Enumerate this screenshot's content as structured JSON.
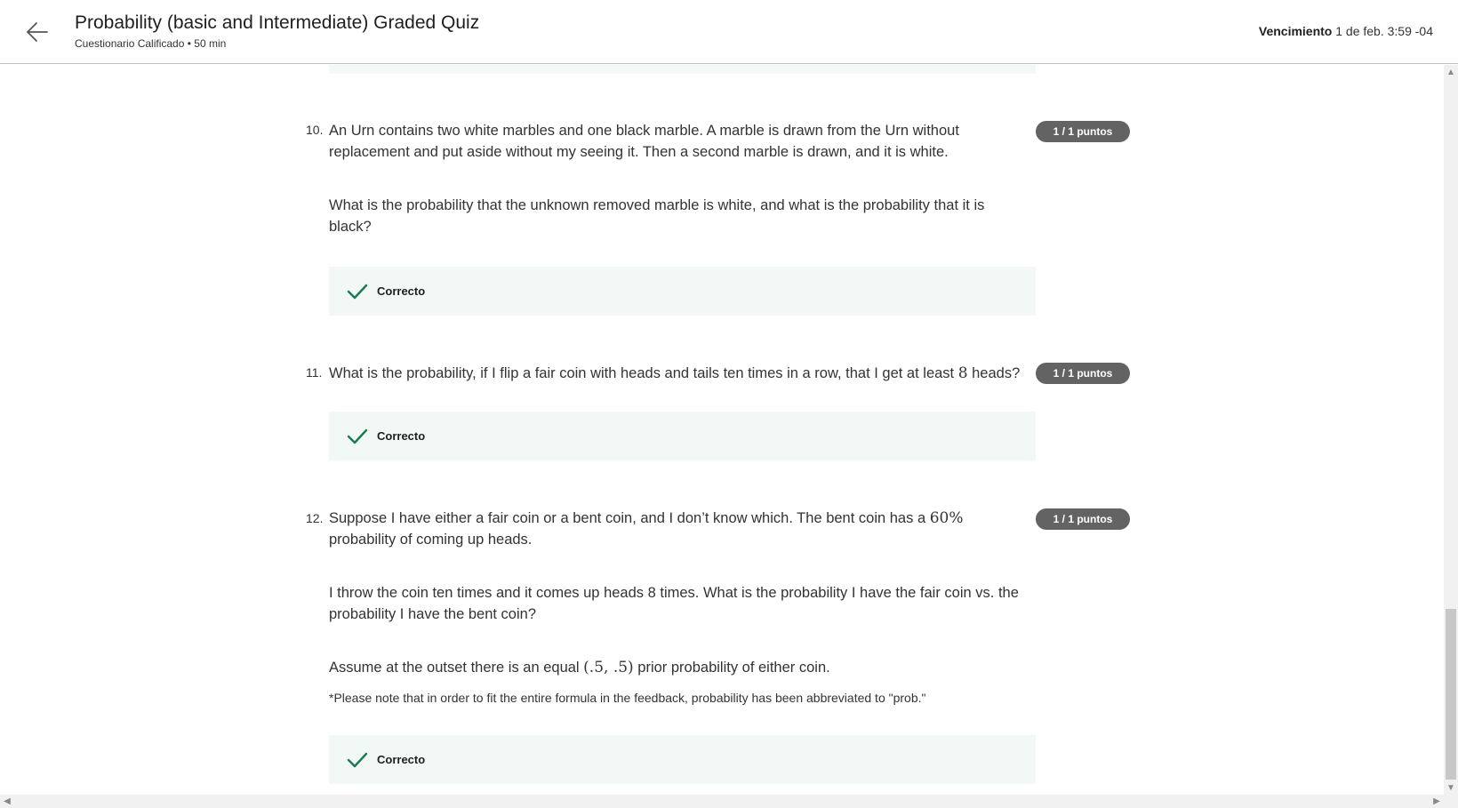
{
  "header": {
    "title": "Probability (basic and Intermediate) Graded Quiz",
    "subtitle": "Cuestionario Calificado • 50 min",
    "due_label": "Vencimiento",
    "due_value": "1 de feb. 3:59 -04"
  },
  "questions": [
    {
      "number": "10.",
      "text_1": "An Urn contains two white marbles and one black marble. A marble is drawn from the Urn without replacement and put aside without my seeing it. Then a second marble is drawn, and it is white.",
      "text_2": "What is the probability that the unknown removed marble is white, and what is the probability that it is black?",
      "badge": "1 / 1 puntos",
      "feedback": "Correcto"
    },
    {
      "number": "11.",
      "text_pre": "What is the probability, if I flip a fair coin with heads and tails ten times in a row, that I get at least ",
      "math": "8",
      "text_post": " heads?",
      "badge": "1 / 1 puntos",
      "feedback": "Correcto"
    },
    {
      "number": "12.",
      "text_pre": "Suppose I have either a fair coin or a bent coin, and I don’t know which. The bent coin has a ",
      "math": "60%",
      "text_post": " probability of coming up heads.",
      "text_2": "I throw the coin ten times and it comes up heads 8 times. What is the probability I have the fair coin vs. the probability I have the bent coin?",
      "text_3_pre": "Assume at the outset there is an equal ",
      "math_2": "(.5, .5)",
      "text_3_post": " prior probability of either coin.",
      "note": "*Please note that in order to fit the entire formula in the feedback, probability has been abbreviated to \"prob.\"",
      "badge": "1 / 1 puntos",
      "feedback": "Correcto"
    }
  ],
  "icons": {
    "back": "arrow-left-icon",
    "check": "checkmark-icon"
  },
  "colors": {
    "badge_bg": "#636363",
    "feedback_bg": "#f2f8f5",
    "check_color": "#1b7a4e"
  }
}
